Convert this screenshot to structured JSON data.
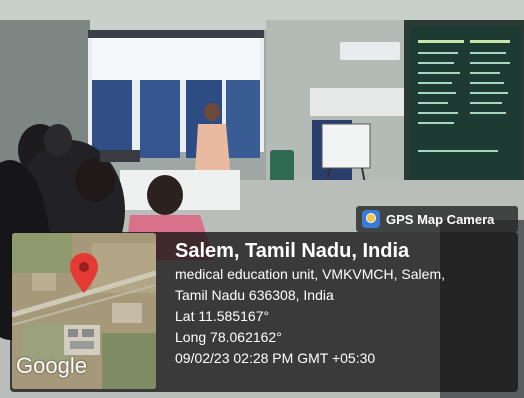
{
  "badge": {
    "label": "GPS Map Camera",
    "icon": "gps-map-camera-icon"
  },
  "map": {
    "logo_text": "Google",
    "pin_icon": "map-pin-icon",
    "pin_color": "#e53935"
  },
  "location": {
    "title": "Salem, Tamil Nadu, India",
    "address_line1": "medical education unit, VMKVMCH, Salem,",
    "address_line2": "Tamil Nadu 636308, India",
    "latitude": "Lat 11.585167°",
    "longitude": "Long 78.062162°",
    "timestamp": "09/02/23 02:28 PM GMT +05:30"
  }
}
